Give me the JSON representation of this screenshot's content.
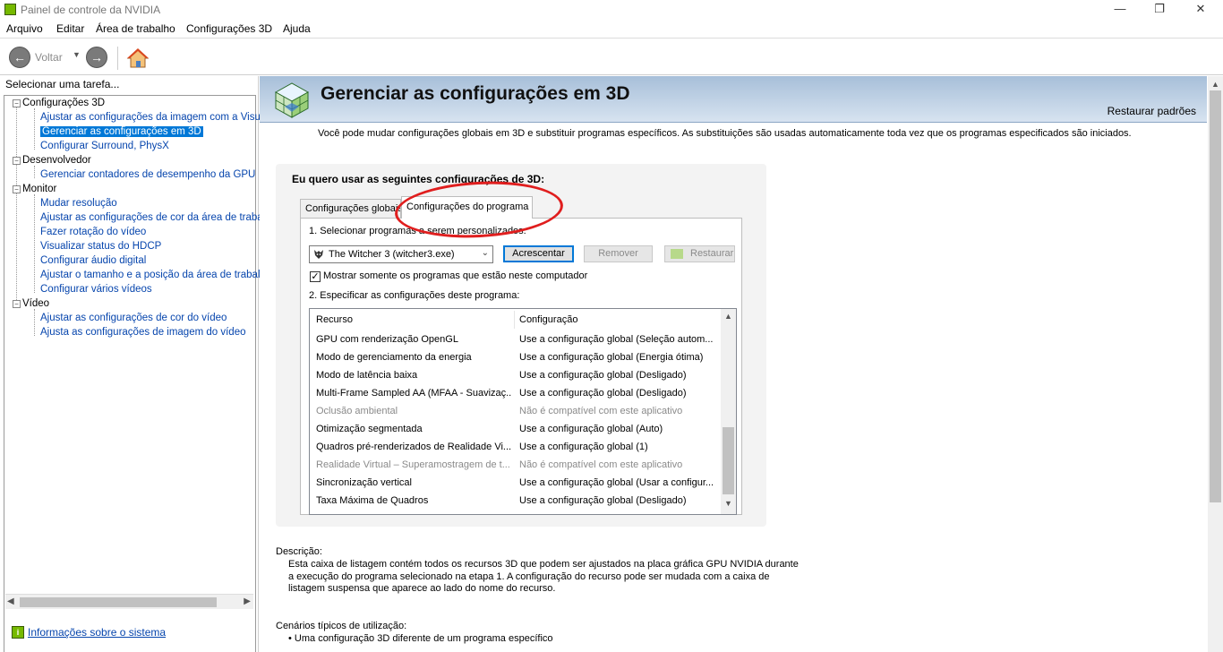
{
  "window": {
    "title": "Painel de controle da NVIDIA",
    "minimize": "—",
    "maximize": "❐",
    "close": "✕"
  },
  "menu": [
    "Arquivo",
    "Editar",
    "Área de trabalho",
    "Configurações 3D",
    "Ajuda"
  ],
  "toolbar": {
    "back_label": "Voltar"
  },
  "sidebar": {
    "header": "Selecionar uma tarefa...",
    "groups": [
      {
        "label": "Configurações 3D",
        "items": [
          "Ajustar as configurações da imagem com a Visuali:",
          "Gerenciar as configurações em 3D",
          "Configurar Surround, PhysX"
        ]
      },
      {
        "label": "Desenvolvedor",
        "items": [
          "Gerenciar contadores de desempenho da GPU"
        ]
      },
      {
        "label": "Monitor",
        "items": [
          "Mudar resolução",
          "Ajustar as configurações de cor da área de trabal",
          "Fazer rotação do vídeo",
          "Visualizar status do HDCP",
          "Configurar áudio digital",
          "Ajustar o tamanho e a posição da área de trabalh",
          "Configurar vários vídeos"
        ]
      },
      {
        "label": "Vídeo",
        "items": [
          "Ajustar as configurações de cor do vídeo",
          "Ajusta as configurações de imagem do vídeo"
        ]
      }
    ],
    "selected_item": "Gerenciar as configurações em 3D",
    "system_info_link": "Informações sobre o sistema"
  },
  "main": {
    "title": "Gerenciar as configurações em 3D",
    "restore_defaults": "Restaurar padrões",
    "intro": "Você pode mudar configurações globais em 3D e substituir programas específicos. As substituições são usadas automaticamente toda vez que os programas especificados são iniciados.",
    "group_heading": "Eu quero usar as seguintes configurações de 3D:",
    "tabs": [
      {
        "label": "Configurações globais",
        "active": false
      },
      {
        "label": "Configurações do programa",
        "active": true
      }
    ],
    "step1_label": "1. Selecionar programas a serem personalizados:",
    "selected_program": "The Witcher 3 (witcher3.exe)",
    "buttons": {
      "add": "Acrescentar",
      "remove": "Remover",
      "restore": "Restaurar"
    },
    "checkbox": {
      "label": "Mostrar somente os programas que estão neste computador",
      "checked": true,
      "mark": "✓"
    },
    "step2_label": "2. Especificar as configurações deste programa:",
    "table": {
      "columns": [
        "Recurso",
        "Configuração"
      ],
      "rows": [
        {
          "feature": "GPU com renderização OpenGL",
          "setting": "Use a configuração global (Seleção autom...",
          "enabled": true
        },
        {
          "feature": "Modo de gerenciamento da energia",
          "setting": "Use a configuração global (Energia ótima)",
          "enabled": true
        },
        {
          "feature": "Modo de latência baixa",
          "setting": "Use a configuração global (Desligado)",
          "enabled": true
        },
        {
          "feature": "Multi-Frame Sampled AA (MFAA - Suavizaç...",
          "setting": "Use a configuração global (Desligado)",
          "enabled": true
        },
        {
          "feature": "Oclusão ambiental",
          "setting": "Não é compatível com este aplicativo",
          "enabled": false
        },
        {
          "feature": "Otimização segmentada",
          "setting": "Use a configuração global (Auto)",
          "enabled": true
        },
        {
          "feature": "Quadros pré-renderizados de Realidade Vi...",
          "setting": "Use a configuração global (1)",
          "enabled": true
        },
        {
          "feature": "Realidade Virtual – Superamostragem de t...",
          "setting": "Não é compatível com este aplicativo",
          "enabled": false
        },
        {
          "feature": "Sincronização vertical",
          "setting": "Use a configuração global (Usar a configur...",
          "enabled": true
        },
        {
          "feature": "Taxa Máxima de Quadros",
          "setting": "Use a configuração global (Desligado)",
          "enabled": true
        }
      ]
    },
    "description_label": "Descrição:",
    "description_text": "Esta caixa de listagem contém todos os recursos 3D que podem ser ajustados na placa gráfica GPU NVIDIA durante a execução do programa selecionado na etapa 1. A configuração do recurso pode ser mudada com a caixa de listagem suspensa que aparece ao lado do nome do recurso.",
    "usage_label": "Cenários típicos de utilização:",
    "usage_items": [
      "• Uma configuração 3D diferente de um programa específico"
    ]
  },
  "colors": {
    "nvidia_green": "#76b900",
    "selection_blue": "#0078d7",
    "link_blue": "#0645ad",
    "annotation_red": "#e01e1e"
  }
}
